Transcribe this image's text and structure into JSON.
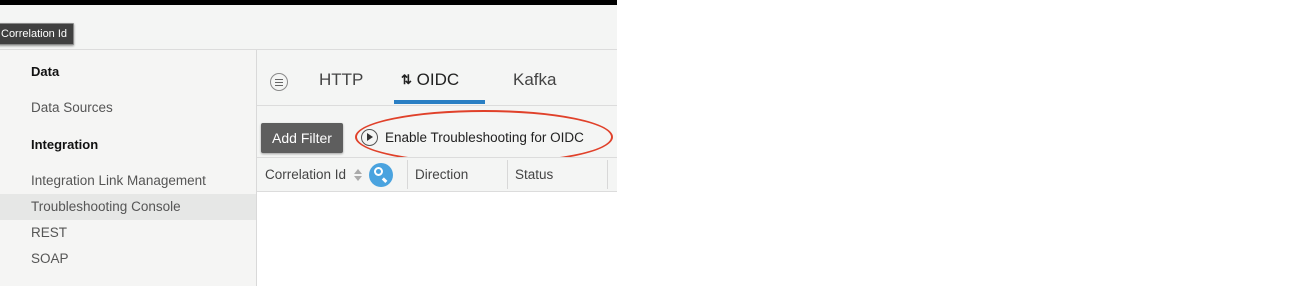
{
  "tooltip": {
    "text": "Correlation Id"
  },
  "sidebar": {
    "items": [
      {
        "label": "Data",
        "type": "heading"
      },
      {
        "label": "Data Sources",
        "type": "link"
      },
      {
        "label": "Integration",
        "type": "heading"
      },
      {
        "label": "Integration Link Management",
        "type": "link"
      },
      {
        "label": "Troubleshooting Console",
        "type": "link",
        "active": true
      },
      {
        "label": "REST",
        "type": "link"
      },
      {
        "label": "SOAP",
        "type": "link"
      }
    ]
  },
  "tabs": {
    "menu_icon": "hamburger-circle-icon",
    "items": [
      {
        "label": "HTTP",
        "active": false
      },
      {
        "label": "OIDC",
        "active": true,
        "icon": "sync-arrows-icon",
        "glyph": "⇅"
      },
      {
        "label": "Kafka",
        "active": false
      }
    ],
    "active_color": "#2a7fc4"
  },
  "toolbar": {
    "add_filter_label": "Add Filter",
    "enable_label": "Enable Troubleshooting for OIDC",
    "highlight_color": "#e0412a"
  },
  "table": {
    "columns": [
      {
        "label": "Correlation Id",
        "sortable": true,
        "searchable": true
      },
      {
        "label": "Direction"
      },
      {
        "label": "Status"
      }
    ],
    "search_color": "#4aa3df"
  }
}
